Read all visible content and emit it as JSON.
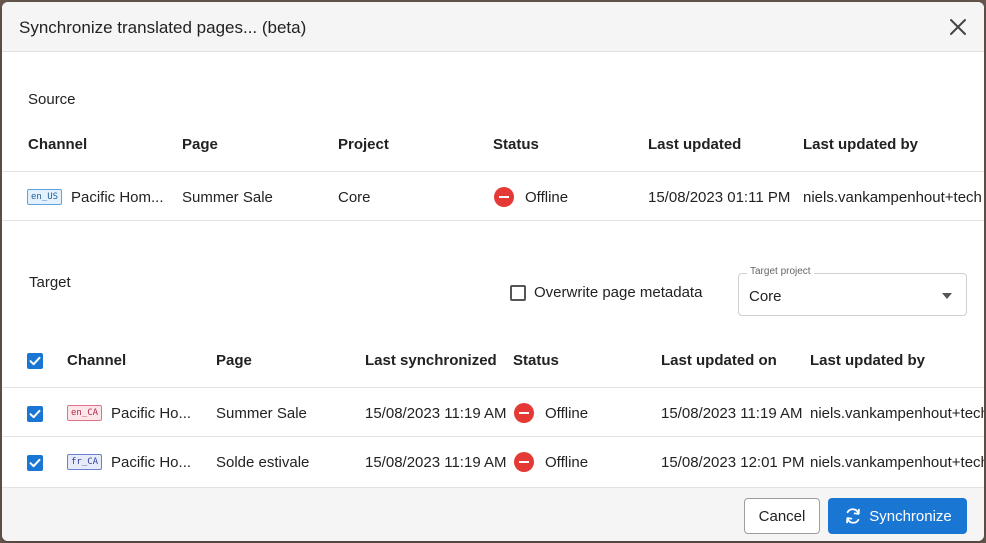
{
  "dialog": {
    "title": "Synchronize translated pages... (beta)"
  },
  "source": {
    "label": "Source",
    "headers": {
      "channel": "Channel",
      "page": "Page",
      "project": "Project",
      "status": "Status",
      "last_updated": "Last updated",
      "last_updated_by": "Last updated by"
    },
    "row": {
      "locale": "en_US",
      "channel": "Pacific Hom...",
      "page": "Summer Sale",
      "project": "Core",
      "status": "Offline",
      "last_updated": "15/08/2023 01:11 PM",
      "last_updated_by": "niels.vankampenhout+tech"
    }
  },
  "target": {
    "label": "Target",
    "overwrite_label": "Overwrite page metadata",
    "overwrite_checked": false,
    "project_select": {
      "legend": "Target project",
      "value": "Core"
    },
    "headers": {
      "channel": "Channel",
      "page": "Page",
      "last_synchronized": "Last synchronized",
      "status": "Status",
      "last_updated_on": "Last updated on",
      "last_updated_by": "Last updated by"
    },
    "select_all_checked": true,
    "rows": [
      {
        "checked": true,
        "locale": "en_CA",
        "channel": "Pacific Ho...",
        "page": "Summer Sale",
        "last_synchronized": "15/08/2023 11:19 AM",
        "status": "Offline",
        "last_updated_on": "15/08/2023 11:19 AM",
        "last_updated_by": "niels.vankampenhout+tech"
      },
      {
        "checked": true,
        "locale": "fr_CA",
        "channel": "Pacific Ho...",
        "page": "Solde estivale",
        "last_synchronized": "15/08/2023 11:19 AM",
        "status": "Offline",
        "last_updated_on": "15/08/2023 12:01 PM",
        "last_updated_by": "niels.vankampenhout+tech"
      }
    ]
  },
  "footer": {
    "cancel_label": "Cancel",
    "synchronize_label": "Synchronize"
  },
  "colors": {
    "primary": "#1976d2",
    "status_offline": "#e53935"
  },
  "icons": {
    "close": "close-icon",
    "status": "offline-status-icon",
    "checkbox": "check-icon",
    "sync": "sync-icon",
    "caret": "chevron-down-icon"
  }
}
